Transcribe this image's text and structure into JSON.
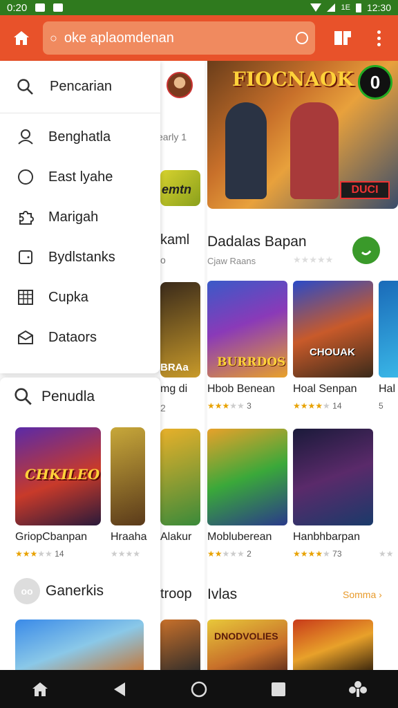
{
  "status_bar": {
    "time_left": "0:20",
    "time_right": "12:30",
    "net": "1E"
  },
  "app_bar": {
    "search_text": "oke aplaomdenan"
  },
  "drawer": {
    "search_label": "Pencarian",
    "items": [
      {
        "label": "Benghatla",
        "icon": "person-icon"
      },
      {
        "label": "East lyahe",
        "icon": "circle-icon"
      },
      {
        "label": "Marigah",
        "icon": "puzzle-icon"
      },
      {
        "label": "Bydlstanks",
        "icon": "tablet-icon"
      },
      {
        "label": "Cupka",
        "icon": "grid-icon"
      },
      {
        "label": "Dataors",
        "icon": "inbox-icon"
      }
    ],
    "section_search": "Penudla",
    "cards": [
      {
        "name": "GriopCbanpan",
        "rating": "14",
        "stars": 3,
        "art": "CHKILEO"
      },
      {
        "name": "Hraaha",
        "rating": "",
        "stars": 0
      }
    ],
    "section_games": "Ganerkis",
    "games_badge": "oo"
  },
  "middle": {
    "text1": "early 1",
    "banner_text": "emtn",
    "title": "kaml",
    "sub": "o",
    "card_label": "BRAa",
    "name1": "mg di",
    "rate1": "2",
    "name2": "Alakur",
    "section": "troop"
  },
  "main": {
    "hero_title": "FIOCNAOK",
    "hero_badge": "0",
    "hero_tag": "DUCI",
    "section_title": "Dadalas Bapan",
    "section_sub": "Cjaw Raans",
    "row1": [
      {
        "name": "Hbob Benean",
        "rating": "3",
        "stars": 3,
        "art": "BURRDOS"
      },
      {
        "name": "Hoal Senpan",
        "rating": "14",
        "stars": 4,
        "art": "CHOUAK"
      },
      {
        "name": "Hal",
        "rating": "5",
        "stars": 0
      }
    ],
    "row2": [
      {
        "name": "Mobluberean",
        "rating": "2",
        "stars": 2
      },
      {
        "name": "Hanbhbarpan",
        "rating": "73",
        "stars": 4
      },
      {
        "name": "",
        "rating": "",
        "stars": 0
      }
    ],
    "section2_title": "Ivlas",
    "section2_more": "Somma",
    "row3_art": "DNODVOLIES"
  }
}
